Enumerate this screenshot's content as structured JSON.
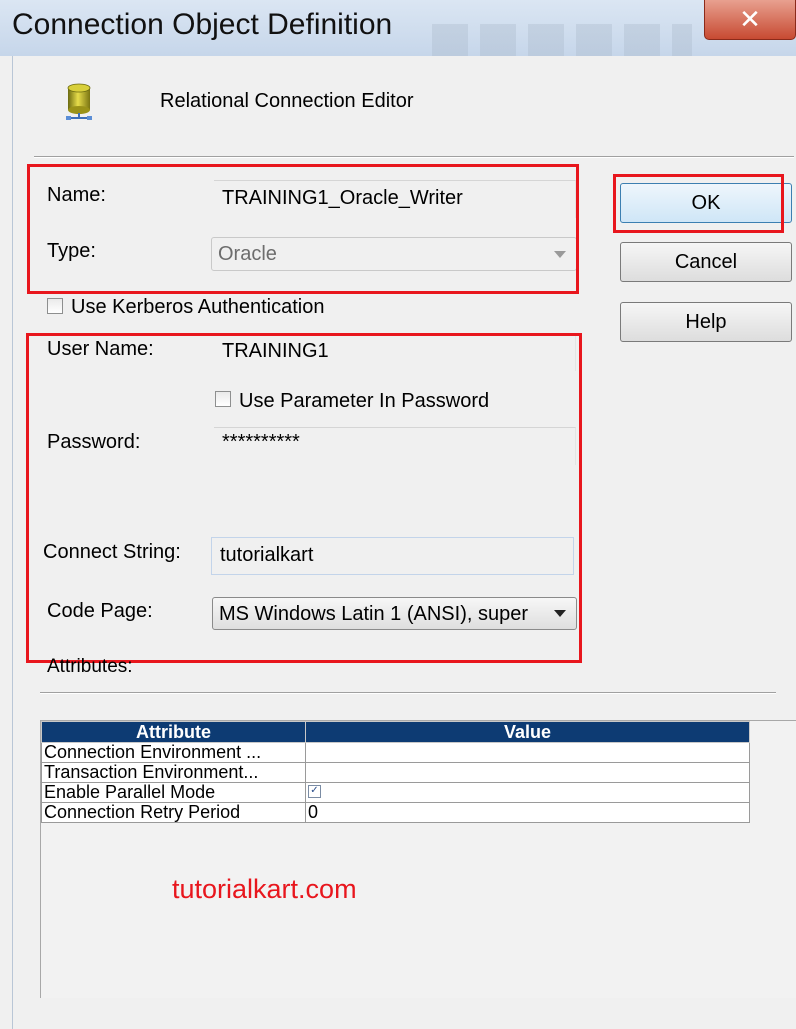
{
  "window": {
    "title": "Connection Object Definition",
    "close_glyph": "✕"
  },
  "header": {
    "editor_title": "Relational Connection Editor",
    "icon": "database-icon"
  },
  "form": {
    "name_label": "Name:",
    "name_value": "TRAINING1_Oracle_Writer",
    "type_label": "Type:",
    "type_value": "Oracle",
    "kerberos_label": "Use Kerberos Authentication",
    "user_name_label": "User Name:",
    "user_name_value": "TRAINING1",
    "use_param_label": "Use Parameter In Password",
    "password_label": "Password:",
    "password_value": "**********",
    "connect_string_label": "Connect String:",
    "connect_string_value": "tutorialkart",
    "code_page_label": "Code Page:",
    "code_page_value": "MS Windows Latin 1 (ANSI), super",
    "attributes_label": "Attributes:"
  },
  "buttons": {
    "ok": "OK",
    "cancel": "Cancel",
    "help": "Help"
  },
  "attributes_table": {
    "headers": [
      "Attribute",
      "Value"
    ],
    "rows": [
      {
        "attribute": "Connection Environment ...",
        "value": ""
      },
      {
        "attribute": "Transaction Environment...",
        "value": ""
      },
      {
        "attribute": "Enable Parallel Mode",
        "value": "✓"
      },
      {
        "attribute": "Connection Retry Period",
        "value": "0"
      }
    ]
  },
  "watermark": "tutorialkart.com",
  "colors": {
    "highlight_red": "#e8161d",
    "table_header": "#0d3b73",
    "watermark": "#e8161d"
  }
}
